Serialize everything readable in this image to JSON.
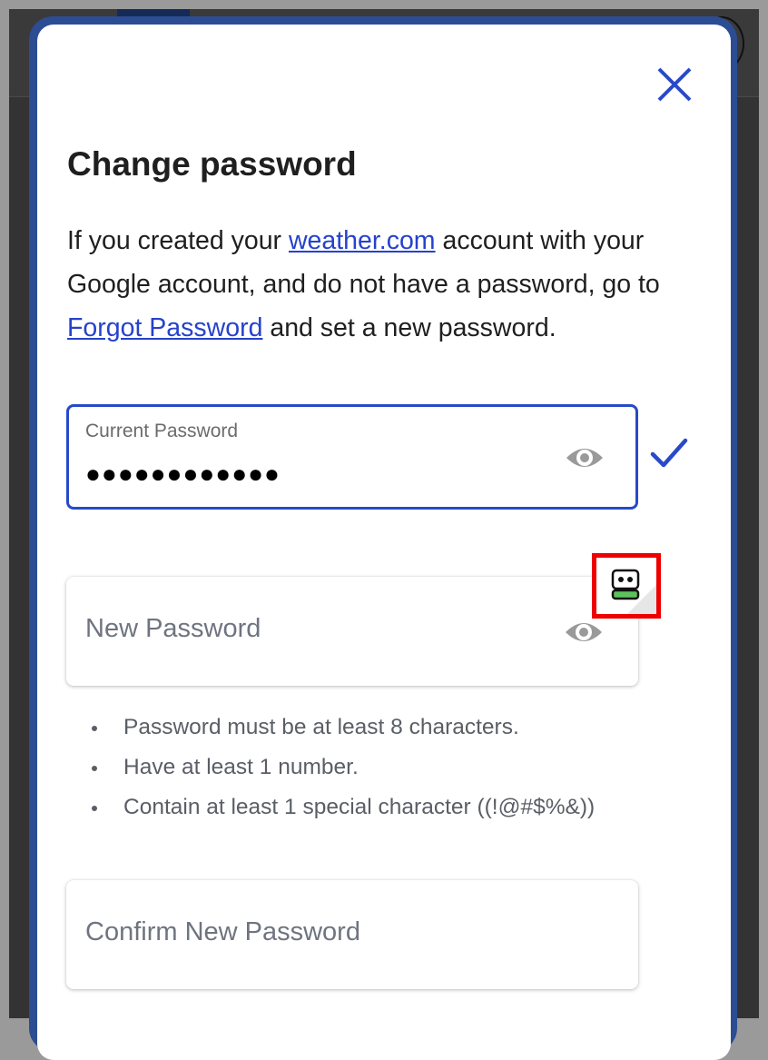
{
  "modal": {
    "title": "Change password",
    "intro": {
      "part1": "If you created your ",
      "link1": "weather.com",
      "part2": " account with your Google account, and do not have a password, go to ",
      "link2": "Forgot Password",
      "part3": " and set a new password."
    },
    "current_password": {
      "label": "Current Password",
      "masked_value": "●●●●●●●●●●●●",
      "valid": true
    },
    "new_password": {
      "placeholder": "New Password",
      "requirements": [
        "Password must be at least 8 characters.",
        "Have at least 1 number.",
        "Contain at least 1 special character ((!@#$%&))"
      ]
    },
    "confirm_password": {
      "placeholder": "Confirm New Password"
    }
  },
  "icons": {
    "close": "close-icon",
    "eye": "eye-icon",
    "check": "check-icon",
    "password_manager": "password-manager-icon"
  },
  "colors": {
    "accent": "#2849c8",
    "link": "#2542cc",
    "highlight_box": "#ee0000",
    "manager_green": "#5cc35c"
  }
}
